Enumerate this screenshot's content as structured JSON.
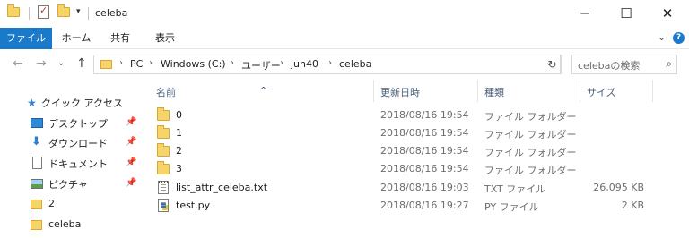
{
  "window": {
    "title": "celeba",
    "controls": {
      "minimize": "─",
      "maximize": "☐",
      "close": "✕"
    },
    "qa_dropdown": "▾"
  },
  "ribbon": {
    "tabs": [
      "ファイル",
      "ホーム",
      "共有",
      "表示"
    ],
    "collapse": "⌄",
    "help": "?"
  },
  "address": {
    "back": "←",
    "forward": "→",
    "recent": "⌄",
    "up": "↑",
    "crumbs": [
      "PC",
      "Windows (C:)",
      "ユーザー",
      "jun40",
      "celeba"
    ],
    "separator": "›",
    "dropdown": "⌄",
    "refresh": "↻",
    "search_placeholder": "celebaの検索",
    "search_icon_glyph": "⌕"
  },
  "sidebar": {
    "quick_access": "クイック アクセス",
    "pin_glyph": "📌",
    "items": [
      {
        "label": "デスクトップ",
        "icon": "desktop-icon",
        "pinned": true
      },
      {
        "label": "ダウンロード",
        "icon": "download-icon",
        "pinned": true
      },
      {
        "label": "ドキュメント",
        "icon": "document-icon",
        "pinned": true
      },
      {
        "label": "ピクチャ",
        "icon": "picture-icon",
        "pinned": true
      },
      {
        "label": "2",
        "icon": "folder-icon",
        "pinned": false
      },
      {
        "label": "celeba",
        "icon": "folder-icon",
        "pinned": false
      }
    ]
  },
  "list": {
    "columns": {
      "name": "名前",
      "date": "更新日時",
      "type": "種類",
      "size": "サイズ"
    },
    "sort_glyph": "^",
    "rows": [
      {
        "name": "0",
        "date": "2018/08/16 19:54",
        "type": "ファイル フォルダー",
        "size": "",
        "icon": "folder-icon"
      },
      {
        "name": "1",
        "date": "2018/08/16 19:54",
        "type": "ファイル フォルダー",
        "size": "",
        "icon": "folder-icon"
      },
      {
        "name": "2",
        "date": "2018/08/16 19:54",
        "type": "ファイル フォルダー",
        "size": "",
        "icon": "folder-icon"
      },
      {
        "name": "3",
        "date": "2018/08/16 19:54",
        "type": "ファイル フォルダー",
        "size": "",
        "icon": "folder-icon"
      },
      {
        "name": "list_attr_celeba.txt",
        "date": "2018/08/16 19:03",
        "type": "TXT ファイル",
        "size": "26,095 KB",
        "icon": "text-file-icon"
      },
      {
        "name": "test.py",
        "date": "2018/08/16 19:27",
        "type": "PY ファイル",
        "size": "2 KB",
        "icon": "python-file-icon"
      }
    ]
  },
  "colors": {
    "accent": "#1979ca",
    "folder": "#f7d46a",
    "header_text": "#4c607a",
    "muted_text": "#6d6d6d"
  }
}
